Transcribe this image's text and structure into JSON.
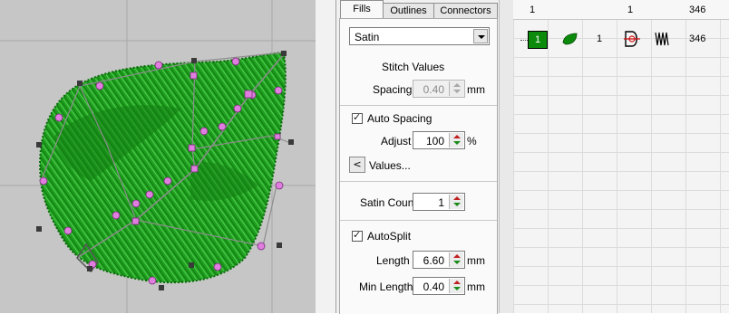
{
  "panel": {
    "tabs": [
      {
        "label": "Fills",
        "active": true
      },
      {
        "label": "Outlines",
        "active": false
      },
      {
        "label": "Connectors",
        "active": false
      }
    ],
    "fill_type": "Satin",
    "section_title": "Stitch Values",
    "spacing_label": "Spacing",
    "spacing_value": "0.40",
    "spacing_unit": "mm",
    "auto_spacing_label": "Auto Spacing",
    "auto_spacing_checked": true,
    "adjust_label": "Adjust",
    "adjust_value": "100",
    "adjust_unit": "%",
    "values_button_icon": "<",
    "values_label": "Values...",
    "satin_count_label": "Satin Count",
    "satin_count_value": "1",
    "autosplit_label": "AutoSplit",
    "autosplit_checked": true,
    "length_label": "Length",
    "length_value": "6.60",
    "length_unit": "mm",
    "min_length_label": "Min Length",
    "min_length_value": "0.40",
    "min_length_unit": "mm"
  },
  "sequence": {
    "header": [
      "1",
      "1",
      "346"
    ],
    "row": {
      "color_number": "1",
      "color": "#0c8a0c",
      "shape_icon": "leaf-icon",
      "object_number": "1",
      "type_icon": "digitize-icon",
      "stitch_icon": "satin-stitch-icon",
      "stitch_count": "346"
    }
  },
  "canvas": {
    "embroidery_color": "#1fa81f",
    "handle_color": "#e07ee0"
  }
}
